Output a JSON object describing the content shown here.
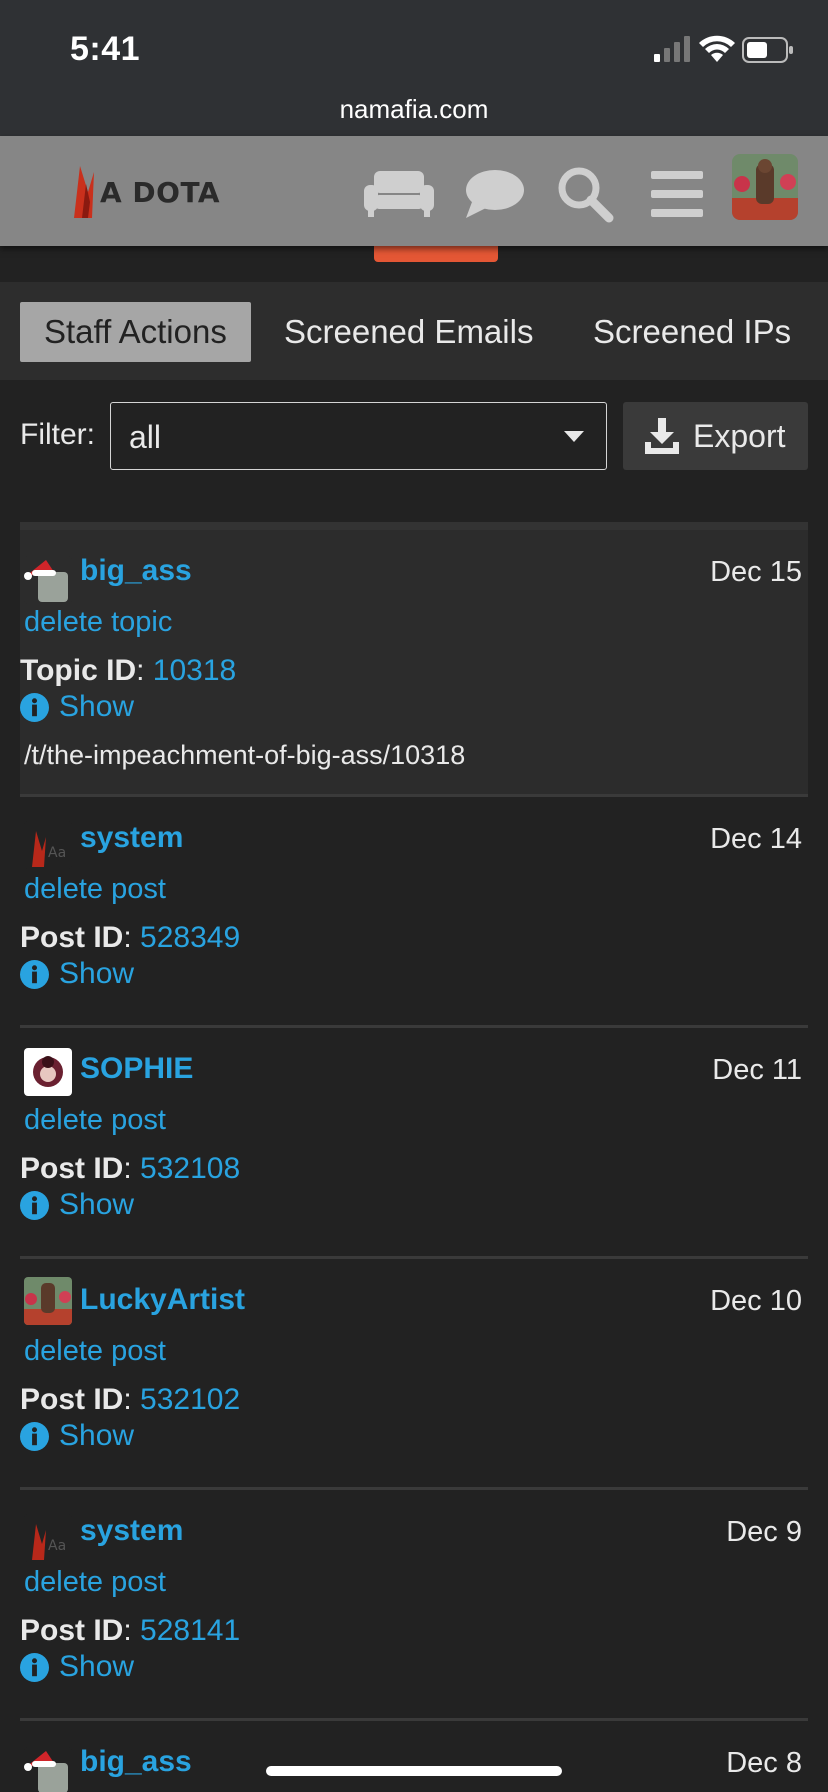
{
  "status_bar": {
    "time": "5:41",
    "url": "namafia.com"
  },
  "header": {
    "logo_text": "A DOTA",
    "icons": [
      "couch-icon",
      "chat-icon",
      "search-icon",
      "hamburger-menu-icon"
    ]
  },
  "tabs": [
    {
      "label": "Staff Actions",
      "active": true
    },
    {
      "label": "Screened Emails",
      "active": false
    },
    {
      "label": "Screened IPs",
      "active": false
    }
  ],
  "filter": {
    "label": "Filter:",
    "value": "all",
    "export_label": "Export"
  },
  "show_label": "Show",
  "entries": [
    {
      "username": "big_ass",
      "date": "Dec 15",
      "action": "delete topic",
      "id_key": "Topic ID",
      "id_value": "10318",
      "details": "/t/the-impeachment-of-big-ass/10318"
    },
    {
      "username": "system",
      "date": "Dec 14",
      "action": "delete post",
      "id_key": "Post ID",
      "id_value": "528349"
    },
    {
      "username": "SOPHIE",
      "date": "Dec 11",
      "action": "delete post",
      "id_key": "Post ID",
      "id_value": "532108"
    },
    {
      "username": "LuckyArtist",
      "date": "Dec 10",
      "action": "delete post",
      "id_key": "Post ID",
      "id_value": "532102"
    },
    {
      "username": "system",
      "date": "Dec 9",
      "action": "delete post",
      "id_key": "Post ID",
      "id_value": "528141"
    },
    {
      "username": "big_ass",
      "date": "Dec 8"
    }
  ],
  "colors": {
    "link": "#29a3e0",
    "header_bg": "#868686",
    "accent": "#e45735",
    "page_bg": "#222222"
  }
}
